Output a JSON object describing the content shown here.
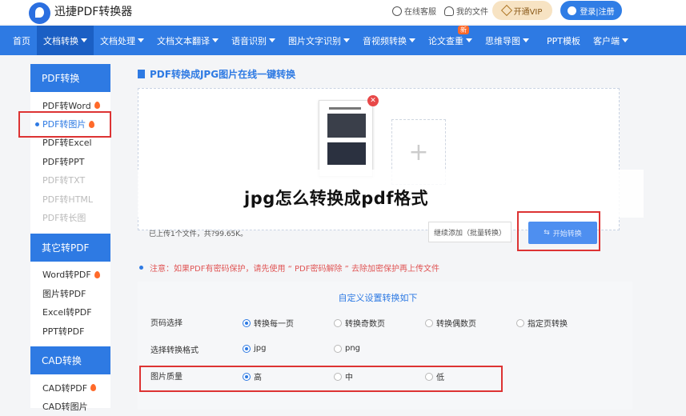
{
  "header": {
    "logo_text": "迅捷PDF转换器",
    "online_service": "在线客服",
    "my_files": "我的文件",
    "vip_button": "开通VIP",
    "login_button": "登录|注册"
  },
  "nav": {
    "items": [
      {
        "label": "首页",
        "caret": false
      },
      {
        "label": "文档转换",
        "caret": true
      },
      {
        "label": "文档处理",
        "caret": true
      },
      {
        "label": "文档文本翻译",
        "caret": true
      },
      {
        "label": "语音识别",
        "caret": true
      },
      {
        "label": "图片文字识别",
        "caret": true
      },
      {
        "label": "音视频转换",
        "caret": true
      },
      {
        "label": "论文查重",
        "caret": true
      },
      {
        "label": "思维导图",
        "caret": true
      },
      {
        "label": "PPT模板",
        "caret": false
      },
      {
        "label": "客户端",
        "caret": true
      }
    ],
    "new_badge": "新"
  },
  "sidebar": {
    "pdf_section": "PDF转换",
    "pdf_items": [
      "PDF转Word",
      "PDF转图片",
      "PDF转Excel",
      "PDF转PPT",
      "PDF转TXT",
      "PDF转HTML",
      "PDF转长图"
    ],
    "other_section": "其它转PDF",
    "other_items": [
      "Word转PDF",
      "图片转PDF",
      "Excel转PDF",
      "PPT转PDF"
    ],
    "cad_section": "CAD转换",
    "cad_items": [
      "CAD转PDF",
      "CAD转图片"
    ]
  },
  "main": {
    "title": "PDF转换成JPG图片在线一键转换",
    "overlay_title": "jpg怎么转换成pdf格式",
    "upload_status": "已上传1个文件，共?99.65K。",
    "batch_add_button": "继续添加（批量转换）",
    "start_button": "开始转换",
    "notice": "注意：如果PDF有密码保护，请先使用  “ PDF密码解除 ”  去除加密保护再上传文件",
    "settings": {
      "heading": "自定义设置转换如下",
      "page_label": "页码选择",
      "page_options": [
        "转换每一页",
        "转换奇数页",
        "转换偶数页",
        "指定页转换"
      ],
      "format_label": "选择转换格式",
      "format_options": [
        "jpg",
        "png"
      ],
      "quality_label": "图片质量",
      "quality_options": [
        "高",
        "中",
        "低"
      ]
    }
  },
  "colors": {
    "brand_blue": "#2e7ae3",
    "highlight_red": "#d33333"
  }
}
